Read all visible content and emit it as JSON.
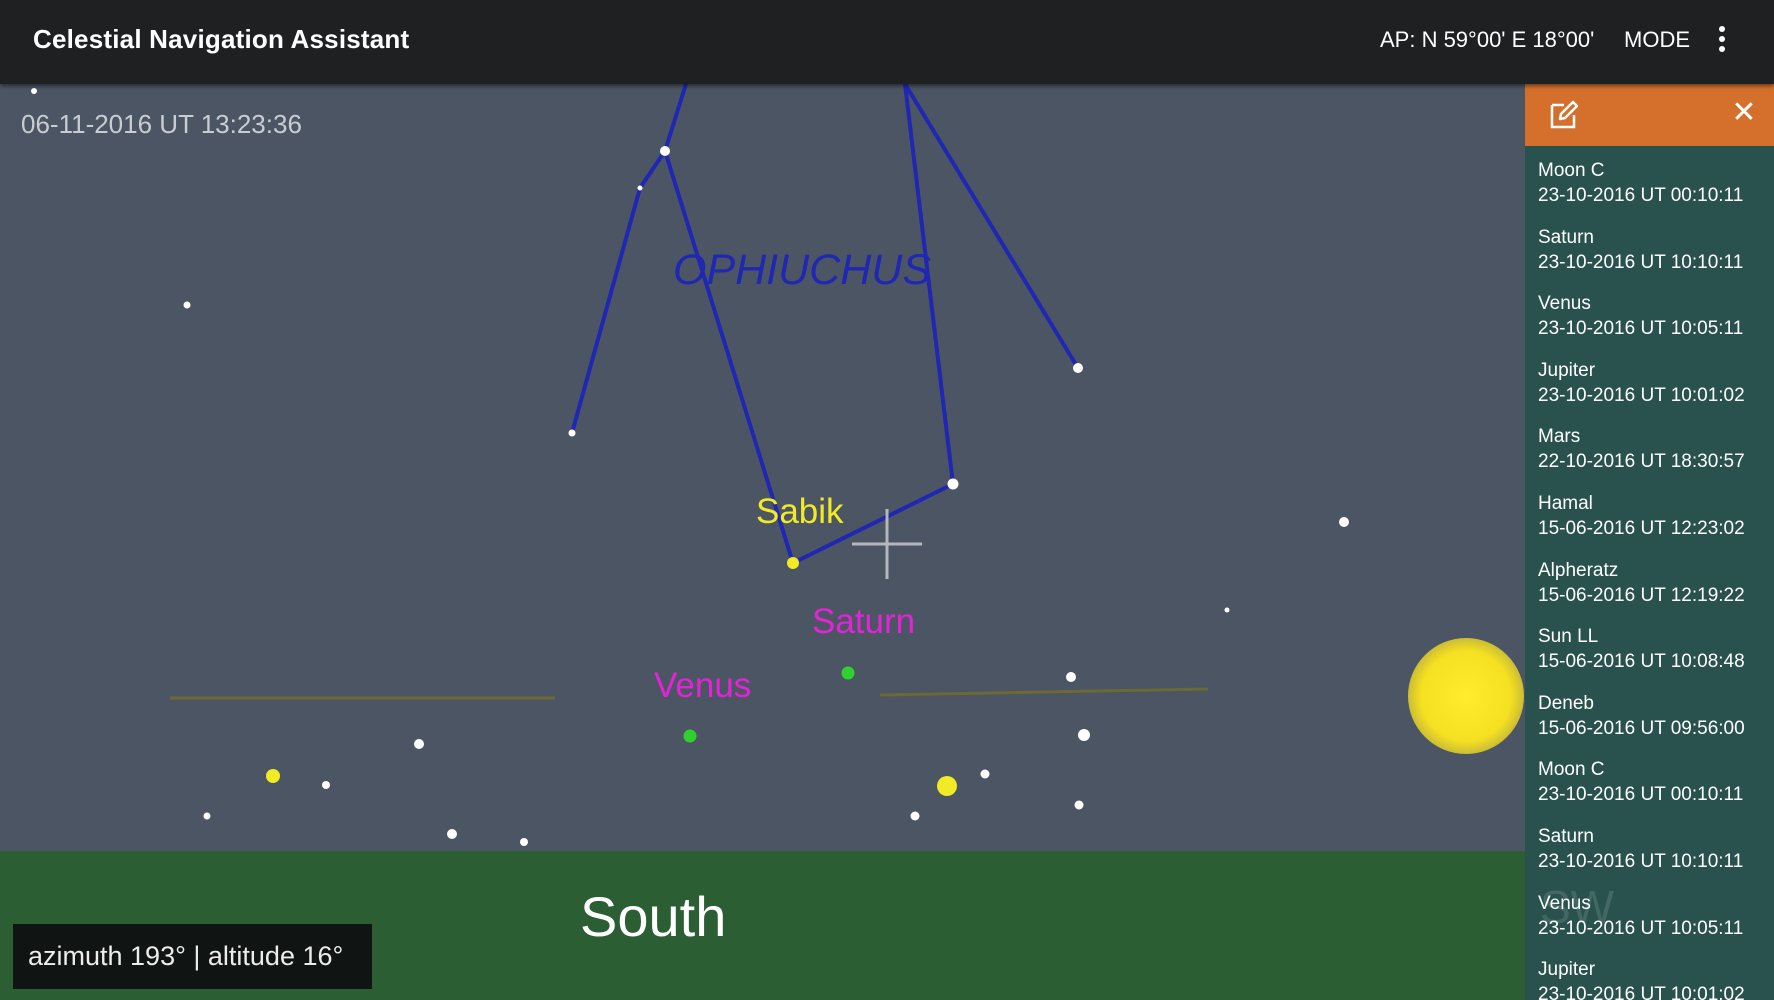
{
  "appbar": {
    "title": "Celestial Navigation Assistant",
    "ap_position": "AP:  N 59°00'  E 18°00'",
    "mode_label": "MODE",
    "overflow_icon": "more-vert-icon"
  },
  "sky": {
    "timestamp": "06-11-2016 UT 13:23:36",
    "constellation": "OPHIUCHUS",
    "labels": {
      "sabik": "Sabik",
      "saturn": "Saturn",
      "venus": "Venus"
    },
    "colors": {
      "background": "#4c5563",
      "constellation_lines": "#1f27b3",
      "star_label": "#f2ea24",
      "planet_label": "#e323d6",
      "planet_dot": "#2fd12f",
      "ground": "#2b5e33",
      "sun": "#f5e022"
    }
  },
  "ground": {
    "direction": "South",
    "readout": "azimuth 193° | altitude 16°"
  },
  "panel": {
    "header_color": "#d4702c",
    "background_color": "#29524f",
    "edit_icon": "edit-icon",
    "close_icon": "close-icon",
    "items": [
      {
        "name": "Moon C",
        "time": "23-10-2016 UT 00:10:11"
      },
      {
        "name": "Saturn",
        "time": "23-10-2016 UT 10:10:11"
      },
      {
        "name": "Venus",
        "time": "23-10-2016 UT 10:05:11"
      },
      {
        "name": "Jupiter",
        "time": "23-10-2016 UT 10:01:02"
      },
      {
        "name": "Mars",
        "time": "22-10-2016 UT 18:30:57"
      },
      {
        "name": "Hamal",
        "time": "15-06-2016 UT 12:23:02"
      },
      {
        "name": "Alpheratz",
        "time": "15-06-2016 UT 12:19:22"
      },
      {
        "name": "Sun LL",
        "time": "15-06-2016 UT 10:08:48"
      },
      {
        "name": "Deneb",
        "time": "15-06-2016 UT 09:56:00"
      },
      {
        "name": "Moon C",
        "time": "23-10-2016 UT 00:10:11"
      },
      {
        "name": "Saturn",
        "time": "23-10-2016 UT 10:10:11"
      },
      {
        "name": "Venus",
        "time": "23-10-2016 UT 10:05:11"
      },
      {
        "name": "Jupiter",
        "time": "23-10-2016 UT 10:01:02"
      }
    ]
  },
  "watermark": "SW"
}
